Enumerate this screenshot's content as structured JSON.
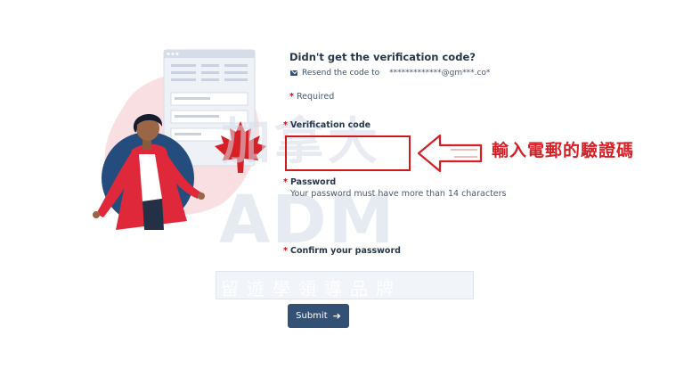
{
  "form": {
    "heading": "Didn't get the verification code?",
    "resend_text": "Resend the code to",
    "masked_email": "*************@gm***.co*",
    "required_note": "Required",
    "required_mark": "*",
    "verification_label": "Verification code",
    "verification_value": "",
    "password_label": "Password",
    "password_hint": "Your password must have more than 14 characters",
    "password_value": "",
    "confirm_label": "Confirm your password",
    "confirm_value": "",
    "submit_label": "Submit"
  },
  "annotation": {
    "text": "輸入電郵的驗證碼",
    "color": "#d71f26"
  },
  "watermark": {
    "big_text": "加拿大",
    "brand": "ADM",
    "subtitle": "留遊學領導品牌"
  },
  "colors": {
    "accent": "#335075",
    "required": "#d3080c",
    "highlight_border": "#d0191a"
  },
  "icons": {
    "resend": "mail-icon",
    "submit": "arrow-right-icon",
    "illustration_leaf": "maple-leaf-icon"
  }
}
